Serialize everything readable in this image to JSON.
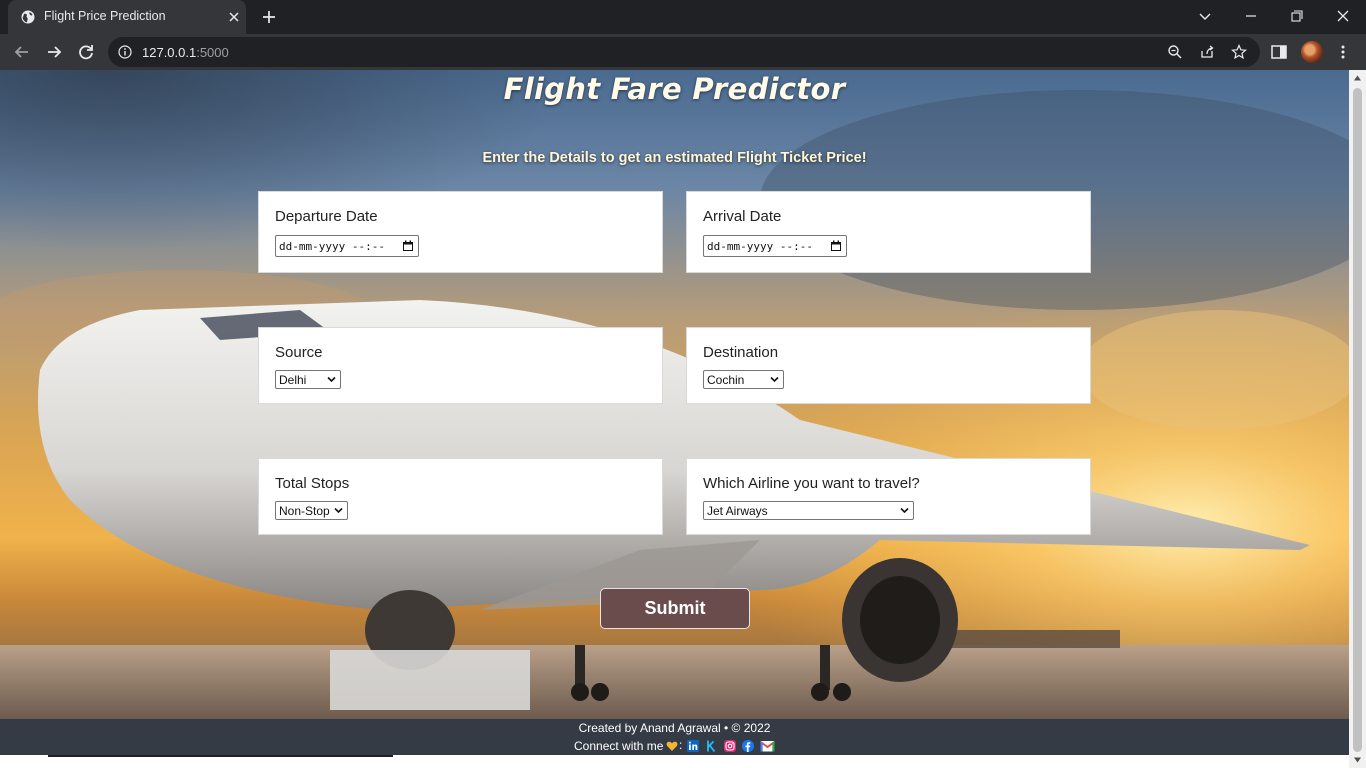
{
  "browser": {
    "tab_title": "Flight Price Prediction",
    "url_host": "127.0.0.1",
    "url_port": ":5000"
  },
  "page": {
    "title": "Flight Fare Predictor",
    "subtitle": "Enter the Details to get an estimated Flight Ticket Price!",
    "fields": {
      "departure": {
        "label": "Departure Date",
        "value": "dd-mm-yyyy --:--"
      },
      "arrival": {
        "label": "Arrival Date",
        "value": "dd-mm-yyyy --:--"
      },
      "source": {
        "label": "Source",
        "selected": "Delhi"
      },
      "destination": {
        "label": "Destination",
        "selected": "Cochin"
      },
      "stops": {
        "label": "Total Stops",
        "selected": "Non-Stop"
      },
      "airline": {
        "label": "Which Airline you want to travel?",
        "selected": "Jet Airways"
      }
    },
    "submit_label": "Submit"
  },
  "footer": {
    "credit": "Created by Anand Agrawal • © 2022",
    "connect": "Connect with me",
    "social_icons": [
      "heart-icon",
      "linkedin-icon",
      "kaggle-icon",
      "instagram-icon",
      "facebook-icon",
      "gmail-icon"
    ]
  },
  "colors": {
    "submit_bg": "#6a4c4c",
    "footer_bg": "#353b45",
    "chrome_dark": "#202124",
    "chrome_toolbar": "#35363a"
  }
}
